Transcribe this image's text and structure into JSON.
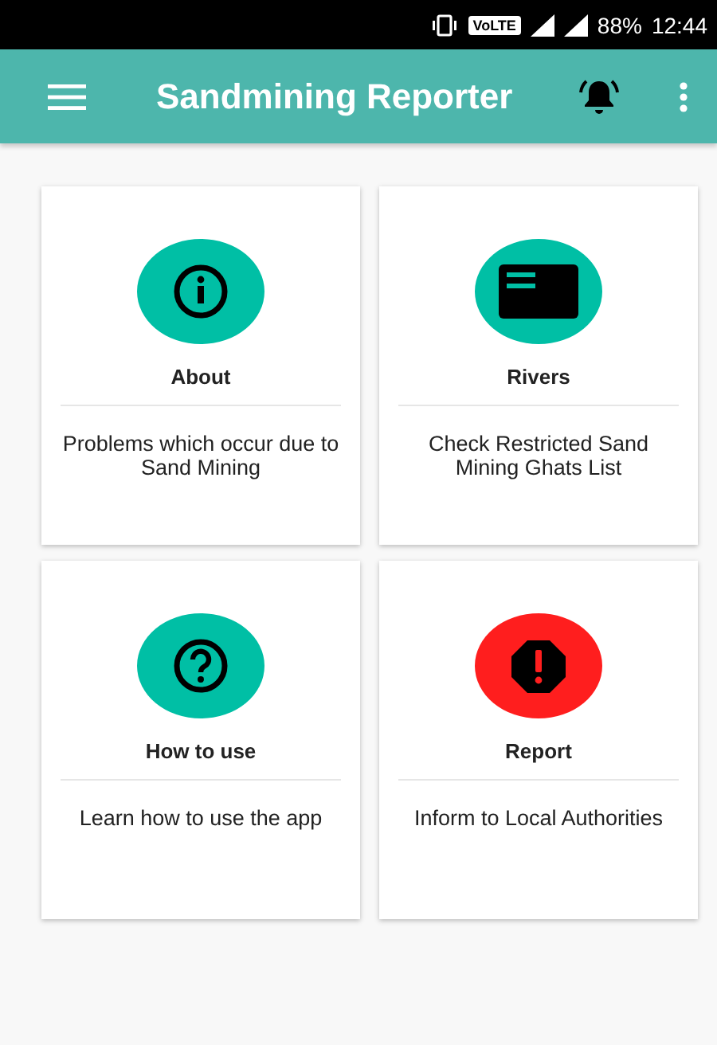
{
  "status_bar": {
    "network_badge": "VoLTE",
    "battery": "88%",
    "time": "12:44"
  },
  "toolbar": {
    "title": "Sandmining Reporter"
  },
  "cards": [
    {
      "title": "About",
      "description": "Problems which occur due to Sand Mining",
      "kind": "info",
      "color": "#00bfa5"
    },
    {
      "title": "Rivers",
      "description": "Check Restricted Sand Mining Ghats List",
      "kind": "card",
      "color": "#00bfa5"
    },
    {
      "title": "How to use",
      "description": "Learn how to use the app",
      "kind": "question",
      "color": "#00bfa5"
    },
    {
      "title": "Report",
      "description": "Inform to Local Authorities",
      "kind": "alert",
      "color": "#ff1e1e"
    }
  ]
}
